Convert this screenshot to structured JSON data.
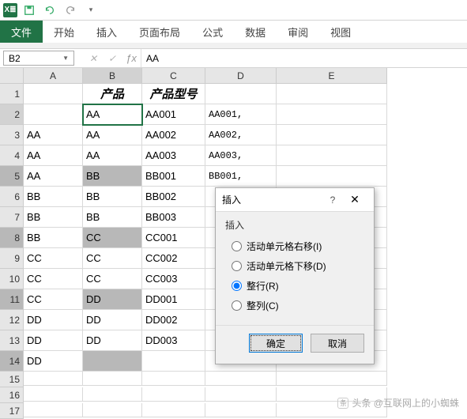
{
  "qat": {
    "save": "保存",
    "undo": "撤销",
    "redo": "重做"
  },
  "ribbon": {
    "file": "文件",
    "tabs": [
      "开始",
      "插入",
      "页面布局",
      "公式",
      "数据",
      "审阅",
      "视图"
    ]
  },
  "namebox": {
    "ref": "B2"
  },
  "formula": {
    "value": "AA"
  },
  "columns": [
    "A",
    "B",
    "C",
    "D",
    "E"
  ],
  "headers": {
    "b": "产品",
    "c": "产品型号"
  },
  "rows": [
    {
      "n": 1,
      "a": "",
      "b": "",
      "c": "",
      "d": "",
      "e": ""
    },
    {
      "n": 2,
      "a": "",
      "b": "AA",
      "c": "AA001",
      "d": "AA001,",
      "e": ""
    },
    {
      "n": 3,
      "a": "AA",
      "b": "AA",
      "c": "AA002",
      "d": "AA002,",
      "e": ""
    },
    {
      "n": 4,
      "a": "AA",
      "b": "AA",
      "c": "AA003",
      "d": "AA003,",
      "e": ""
    },
    {
      "n": 5,
      "a": "AA",
      "b": "BB",
      "c": "BB001",
      "d": "BB001,",
      "e": ""
    },
    {
      "n": 6,
      "a": "BB",
      "b": "BB",
      "c": "BB002",
      "d": "",
      "e": ""
    },
    {
      "n": 7,
      "a": "BB",
      "b": "BB",
      "c": "BB003",
      "d": "",
      "e": ""
    },
    {
      "n": 8,
      "a": "BB",
      "b": "CC",
      "c": "CC001",
      "d": "",
      "e": ""
    },
    {
      "n": 9,
      "a": "CC",
      "b": "CC",
      "c": "CC002",
      "d": "",
      "e": ""
    },
    {
      "n": 10,
      "a": "CC",
      "b": "CC",
      "c": "CC003",
      "d": "",
      "e": ""
    },
    {
      "n": 11,
      "a": "CC",
      "b": "DD",
      "c": "DD001",
      "d": "",
      "e": ""
    },
    {
      "n": 12,
      "a": "DD",
      "b": "DD",
      "c": "DD002",
      "d": "",
      "e": ""
    },
    {
      "n": 13,
      "a": "DD",
      "b": "DD",
      "c": "DD003",
      "d": "",
      "e": ""
    },
    {
      "n": 14,
      "a": "DD",
      "b": "",
      "c": "",
      "d": "",
      "e": ""
    },
    {
      "n": 15,
      "a": "",
      "b": "",
      "c": "",
      "d": "",
      "e": ""
    },
    {
      "n": 16,
      "a": "",
      "b": "",
      "c": "",
      "d": "",
      "e": ""
    },
    {
      "n": 17,
      "a": "",
      "b": "",
      "c": "",
      "d": "",
      "e": ""
    }
  ],
  "highlights": {
    "b5": true,
    "b8": true,
    "b11": true,
    "b14": true,
    "rh5": true,
    "rh8": true,
    "rh11": true,
    "rh14": true
  },
  "dialog": {
    "title": "插入",
    "group": "插入",
    "opt1": "活动单元格右移(I)",
    "opt2": "活动单元格下移(D)",
    "opt3": "整行(R)",
    "opt4": "整列(C)",
    "selected": 3,
    "ok": "确定",
    "cancel": "取消"
  },
  "watermark": "头条 @互联网上的小蜘蛛"
}
